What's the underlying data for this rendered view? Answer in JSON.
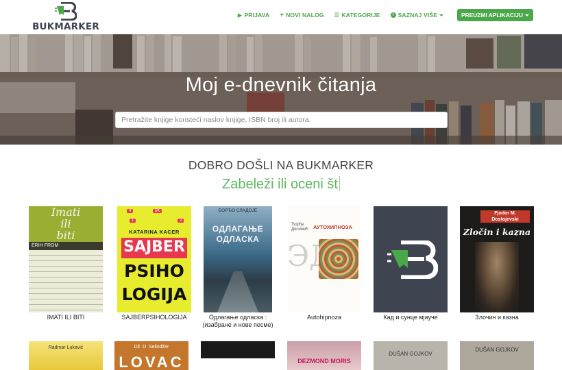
{
  "brand": {
    "name": "BUKMARKER"
  },
  "nav": {
    "items": [
      {
        "label": "PRIJAVA",
        "icon": "login-icon"
      },
      {
        "label": "NOVI NALOG",
        "icon": "plus-icon"
      },
      {
        "label": "KATEGORIJE",
        "icon": "list-icon"
      },
      {
        "label": "SAZNAJ VIŠE",
        "icon": "info-icon"
      }
    ],
    "app_button": "PREUZMI APLIKACIJU"
  },
  "hero": {
    "title": "Moj e-dnevnik čitanja",
    "search_placeholder": "Pretražite knjige koristeći naslov knjige, ISBN broj ili autora."
  },
  "welcome": {
    "heading": "DOBRO DOŠLI NA BUKMARKER",
    "tagline": "Zabeleži ili oceni št"
  },
  "colors": {
    "accent": "#4aa84a",
    "tagline": "#5cb85c",
    "logo_dark": "#3e4550"
  },
  "books_row1": [
    {
      "title": "IMATI ILI BITI",
      "cover": {
        "line1": "Imati",
        "line2": "ili",
        "line3": "biti",
        "author": "ERIH FROM"
      }
    },
    {
      "title": "SAJBERPSIHOLOGIJA",
      "cover": {
        "author": "KATARINA KACER",
        "line1": "SAJBER",
        "line2": "PSIHO",
        "line3": "LOGIJA",
        "badge1": "4",
        "badge2": "5K",
        "badge3": "1",
        "badge4": "2"
      }
    },
    {
      "title": "Одлагање одласка : (изабране и нове песме)",
      "cover": {
        "author": "БОРЂО СЛАДОЈЕ",
        "line1": "ОДЛАГАЊЕ",
        "line2": "ОДЛАСКА"
      }
    },
    {
      "title": "Autohipnoza",
      "cover": {
        "author": "Ђорђе Десимић",
        "line1": "АУТОХИПНОЗА",
        "glyph": "ЭД"
      }
    },
    {
      "title": "Кад и сунце мјауче",
      "cover": {}
    },
    {
      "title": "Злочин и казна",
      "cover": {
        "author": "Fjodor M. Dostojevski",
        "line1": "Zločin i kazna"
      }
    }
  ],
  "books_row2": [
    {
      "cover": {
        "author": "Radmar Lukavić"
      }
    },
    {
      "cover": {
        "author": "Dž. D. Selindžer",
        "line1": "LOVAC"
      }
    },
    {
      "cover": {}
    },
    {
      "cover": {
        "author": "DEZMOND MORIS"
      }
    },
    {
      "cover": {
        "author": "DUŠAN GOJKOV"
      }
    },
    {
      "cover": {
        "author": "DUŠAN GOJKOV"
      }
    }
  ]
}
